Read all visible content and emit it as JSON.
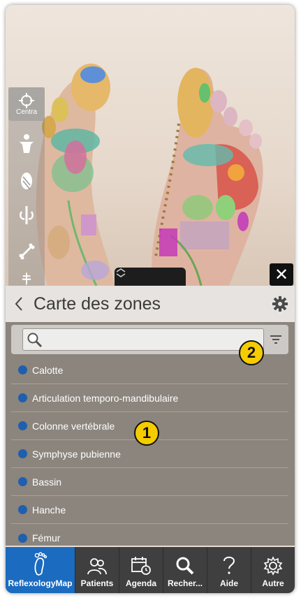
{
  "viewer": {
    "centra_label": "Centra",
    "close_glyph": "✕"
  },
  "panel": {
    "title": "Carte des zones",
    "search": {
      "placeholder": "",
      "value": ""
    },
    "zones": [
      {
        "label": "Calotte"
      },
      {
        "label": "Articulation temporo-mandibulaire"
      },
      {
        "label": "Colonne vertébrale"
      },
      {
        "label": "Symphyse pubienne"
      },
      {
        "label": "Bassin"
      },
      {
        "label": "Hanche"
      },
      {
        "label": "Fémur"
      }
    ]
  },
  "annotations": {
    "badge1": "1",
    "badge2": "2"
  },
  "tabbar": {
    "tabs": [
      {
        "label": "ReflexologyMap",
        "icon": "foot-icon"
      },
      {
        "label": "Patients",
        "icon": "people-icon"
      },
      {
        "label": "Agenda",
        "icon": "calendar-icon"
      },
      {
        "label": "Recher...",
        "icon": "search-icon"
      },
      {
        "label": "Aide",
        "icon": "question-icon"
      },
      {
        "label": "Autre",
        "icon": "gear-icon"
      }
    ]
  },
  "colors": {
    "accent": "#1b6bc0",
    "badge": "#f5cc00",
    "zone_dot": "#1f5fad",
    "panel_bg": "#8b857d"
  }
}
